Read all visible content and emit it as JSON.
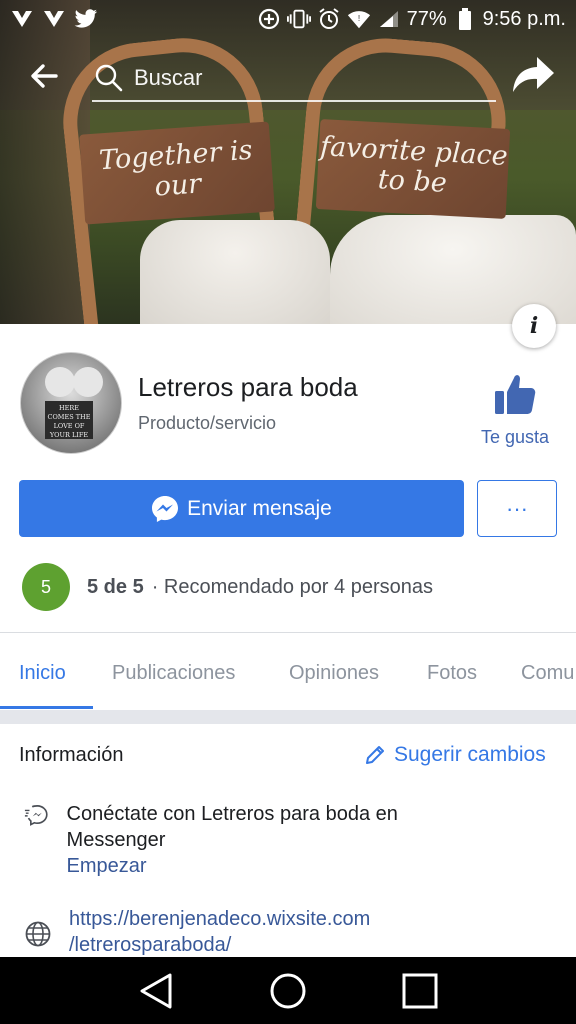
{
  "status_bar": {
    "battery": "77%",
    "time": "9:56 p.m.",
    "icons": [
      "vpn-icon",
      "vpn-icon",
      "twitter-icon",
      "data-saver-icon",
      "vibrate-icon",
      "alarm-icon",
      "wifi-icon",
      "signal-icon",
      "battery-icon"
    ]
  },
  "search": {
    "placeholder": "Buscar"
  },
  "cover": {
    "sign_left": "Together is our",
    "sign_right": "favorite place to be"
  },
  "profile_image_text": "HERE COMES THE LOVE OF YOUR LIFE",
  "page": {
    "name": "Letreros para boda",
    "category": "Producto/servicio",
    "like_label": "Te gusta"
  },
  "actions": {
    "message_label": "Enviar mensaje",
    "more_label": "···"
  },
  "rating": {
    "badge": "5",
    "score": "5 de 5",
    "recommended": "· Recomendado por 4 personas"
  },
  "tabs": [
    {
      "label": "Inicio",
      "active": true
    },
    {
      "label": "Publicaciones",
      "active": false
    },
    {
      "label": "Opiniones",
      "active": false
    },
    {
      "label": "Fotos",
      "active": false
    },
    {
      "label": "Comu",
      "active": false
    }
  ],
  "info": {
    "title": "Información",
    "suggest_label": "Sugerir cambios",
    "messenger_text": "Conéctate con Letreros para boda en Messenger",
    "messenger_link": "Empezar",
    "website_line1": "https://berenjenadeco.wixsite.com",
    "website_line2": "/letrerosparaboda/"
  },
  "colors": {
    "accent": "#3578e5",
    "rating_green": "#5ea130"
  }
}
